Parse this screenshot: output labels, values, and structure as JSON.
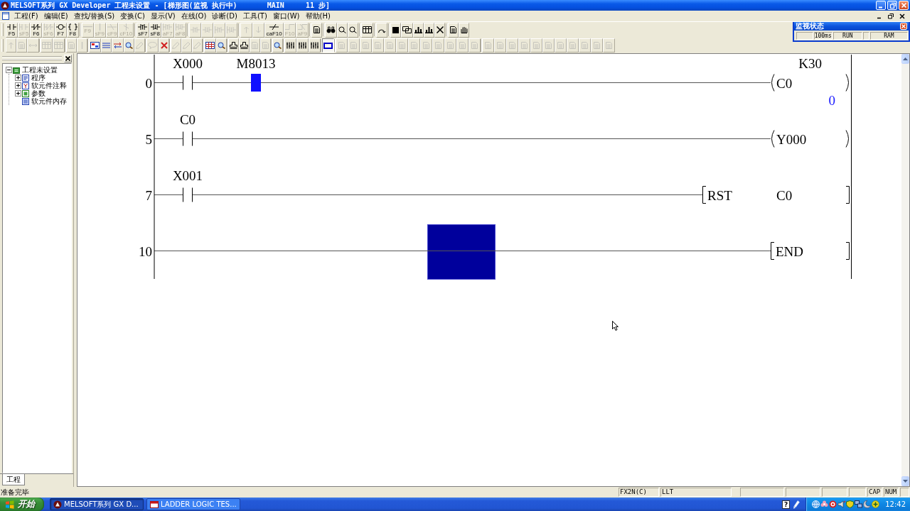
{
  "window": {
    "title": "MELSOFT系列 GX Developer 工程未设置 - [梯形图(监视 执行中)       MAIN     11 步]"
  },
  "menu": [
    "工程(F)",
    "编辑(E)",
    "查找/替换(S)",
    "变换(C)",
    "显示(V)",
    "在线(O)",
    "诊断(D)",
    "工具(T)",
    "窗口(W)",
    "帮助(H)"
  ],
  "toolbars": [
    {
      "groups": [
        [
          {
            "kind": "contact",
            "label": "F5",
            "disabled": false
          },
          {
            "kind": "contact_par",
            "label": "sF5",
            "disabled": true
          },
          {
            "kind": "contact_nc",
            "label": "F6",
            "disabled": false
          },
          {
            "kind": "contact_nc_par",
            "label": "sF6",
            "disabled": true
          },
          {
            "kind": "coil",
            "label": "F7",
            "disabled": false
          },
          {
            "kind": "func",
            "label": "F8",
            "disabled": false
          }
        ],
        [
          {
            "kind": "hline",
            "label": "F9",
            "disabled": true
          },
          {
            "kind": "vline",
            "label": "sF9",
            "disabled": true
          },
          {
            "kind": "hline_del",
            "label": "cF9",
            "disabled": true
          },
          {
            "kind": "vline_del",
            "label": "cF10",
            "disabled": true
          }
        ],
        [
          {
            "kind": "pulse_up",
            "label": "sF7",
            "disabled": false
          },
          {
            "kind": "pulse_down",
            "label": "sF8",
            "disabled": false
          },
          {
            "kind": "pulse_up_par",
            "label": "aF7",
            "disabled": true
          },
          {
            "kind": "pulse_down_par",
            "label": "aF8",
            "disabled": true
          }
        ],
        [
          {
            "kind": "pulse_up",
            "disabled": true
          },
          {
            "kind": "pulse_down",
            "disabled": true
          },
          {
            "kind": "pulse_up_par",
            "disabled": true
          },
          {
            "kind": "pulse_down_par",
            "disabled": true
          }
        ],
        [
          {
            "kind": "arrow_up",
            "disabled": true
          },
          {
            "kind": "arrow_down",
            "disabled": true
          },
          {
            "kind": "invert",
            "label": "caF10",
            "disabled": false
          },
          {
            "kind": "line_draw",
            "label": "F10",
            "disabled": true
          },
          {
            "kind": "line_erase",
            "label": "aF9",
            "disabled": true
          }
        ],
        [
          {
            "kind": "doc",
            "disabled": false
          }
        ],
        [
          {
            "kind": "binoculars",
            "disabled": false
          },
          {
            "kind": "find",
            "disabled": false
          },
          {
            "kind": "find",
            "disabled": false
          }
        ],
        [
          {
            "kind": "table",
            "disabled": false
          }
        ],
        [
          {
            "kind": "loop",
            "disabled": false
          }
        ],
        [
          {
            "kind": "block",
            "disabled": false
          },
          {
            "kind": "windows",
            "disabled": false
          },
          {
            "kind": "chart",
            "disabled": false
          },
          {
            "kind": "chart",
            "disabled": false
          },
          {
            "kind": "cross",
            "disabled": false
          }
        ],
        [
          {
            "kind": "doc",
            "disabled": false
          },
          {
            "kind": "hand",
            "disabled": false
          }
        ]
      ]
    },
    {
      "groups": [
        [
          {
            "kind": "arrow_up",
            "disabled": true
          },
          {
            "kind": "doc",
            "disabled": true
          },
          {
            "kind": "arrows_h",
            "disabled": true
          }
        ],
        [
          {
            "kind": "table",
            "disabled": true
          },
          {
            "kind": "table",
            "disabled": true
          }
        ],
        [
          {
            "kind": "doc",
            "disabled": true
          },
          {
            "kind": "vline",
            "disabled": true
          }
        ],
        [
          {
            "kind": "doc_color",
            "disabled": false
          },
          {
            "kind": "lines",
            "disabled": false
          },
          {
            "kind": "arrows_red",
            "disabled": false
          },
          {
            "kind": "magnifier",
            "disabled": false
          },
          {
            "kind": "pen",
            "disabled": true
          }
        ],
        [
          {
            "kind": "balloon",
            "disabled": true
          },
          {
            "kind": "cross_red",
            "disabled": false
          }
        ],
        [
          {
            "kind": "pen",
            "disabled": true
          },
          {
            "kind": "pen",
            "disabled": true
          },
          {
            "kind": "pen",
            "disabled": true
          }
        ],
        [
          {
            "kind": "grid_color",
            "disabled": false
          },
          {
            "kind": "magnifier",
            "disabled": false
          }
        ],
        [
          {
            "kind": "stamp",
            "disabled": false
          },
          {
            "kind": "stamp",
            "disabled": false
          },
          {
            "kind": "doc",
            "disabled": true
          },
          {
            "kind": "doc",
            "disabled": true
          }
        ],
        [
          {
            "kind": "magnifier",
            "disabled": false
          }
        ],
        [
          {
            "kind": "columns",
            "disabled": false
          },
          {
            "kind": "columns",
            "disabled": false
          },
          {
            "kind": "columns",
            "disabled": false
          }
        ],
        [
          {
            "kind": "frame",
            "disabled": false,
            "pressed": true
          }
        ],
        [
          {
            "kind": "doc",
            "disabled": true
          },
          {
            "kind": "doc",
            "disabled": true
          },
          {
            "kind": "doc",
            "disabled": true
          },
          {
            "kind": "doc",
            "disabled": true
          },
          {
            "kind": "doc",
            "disabled": true
          },
          {
            "kind": "doc",
            "disabled": true
          },
          {
            "kind": "doc",
            "disabled": true
          },
          {
            "kind": "doc",
            "disabled": true
          },
          {
            "kind": "doc",
            "disabled": true
          },
          {
            "kind": "doc",
            "disabled": true
          },
          {
            "kind": "doc",
            "disabled": true
          },
          {
            "kind": "doc",
            "disabled": true
          }
        ],
        [
          {
            "kind": "doc",
            "disabled": true
          },
          {
            "kind": "doc",
            "disabled": true
          },
          {
            "kind": "doc",
            "disabled": true
          },
          {
            "kind": "doc",
            "disabled": true
          },
          {
            "kind": "doc",
            "disabled": true
          },
          {
            "kind": "doc",
            "disabled": true
          },
          {
            "kind": "doc",
            "disabled": true
          },
          {
            "kind": "doc",
            "disabled": true
          },
          {
            "kind": "doc",
            "disabled": true
          },
          {
            "kind": "doc",
            "disabled": true
          },
          {
            "kind": "doc",
            "disabled": true
          }
        ]
      ]
    }
  ],
  "monitor_status": {
    "title": "监视状态",
    "cells": [
      {
        "kind": "blank"
      },
      {
        "kind": "text",
        "text": "100ms"
      },
      {
        "kind": "text",
        "text": "RUN"
      },
      {
        "kind": "blank"
      },
      {
        "kind": "text",
        "text": "RAM"
      }
    ]
  },
  "project_panel": {
    "tree": [
      {
        "label": "工程未设置",
        "kind": "project",
        "expanded": true,
        "children": [
          {
            "label": "程序",
            "kind": "program",
            "expanded": false
          },
          {
            "label": "软元件注释",
            "kind": "comment",
            "expanded": false
          },
          {
            "label": "参数",
            "kind": "parameter",
            "expanded": false
          },
          {
            "label": "软元件内存",
            "kind": "memory"
          }
        ]
      }
    ],
    "tabs": [
      {
        "label": "工程",
        "selected": true
      }
    ]
  },
  "ladder": {
    "rungs": [
      {
        "step": "0",
        "cells": [
          {
            "kind": "contact",
            "device": "X000",
            "on": false
          },
          {
            "kind": "contact",
            "device": "M8013",
            "on": true
          }
        ],
        "output": {
          "kind": "coil",
          "device": "C0",
          "on": false,
          "setting": "K30",
          "current": "0"
        }
      },
      {
        "step": "5",
        "cells": [
          {
            "kind": "contact",
            "device": "C0",
            "on": false
          }
        ],
        "output": {
          "kind": "coil",
          "device": "Y000",
          "on": false
        }
      },
      {
        "step": "7",
        "cells": [
          {
            "kind": "contact",
            "device": "X001",
            "on": false
          }
        ],
        "output": {
          "kind": "instruction",
          "name": "RST",
          "operand": "C0"
        }
      },
      {
        "step": "10",
        "cells": [
          {
            "kind": "wire"
          },
          {
            "kind": "wire"
          },
          {
            "kind": "wire"
          },
          {
            "kind": "wire"
          },
          {
            "kind": "cursor"
          }
        ],
        "output": {
          "kind": "instruction",
          "name": "END"
        }
      }
    ]
  },
  "status_bar": {
    "message": "准备完毕",
    "panels": [
      {
        "kind": "text",
        "text": "FX2N(C)"
      },
      {
        "kind": "text",
        "text": "LLT"
      },
      {
        "kind": "blank"
      },
      {
        "kind": "blank"
      },
      {
        "kind": "blank"
      },
      {
        "kind": "blank"
      },
      {
        "kind": "text",
        "text": "CAP"
      },
      {
        "kind": "text",
        "text": "NUM"
      },
      {
        "kind": "blank"
      }
    ]
  },
  "taskbar": {
    "start": "开始",
    "tasks": [
      {
        "label": "MELSOFT系列 GX D...",
        "kind": "emblem",
        "selected": true
      },
      {
        "label": "LADDER LOGIC TES...",
        "kind": "window",
        "selected": false
      }
    ],
    "help": "?",
    "clock": "12:42"
  }
}
